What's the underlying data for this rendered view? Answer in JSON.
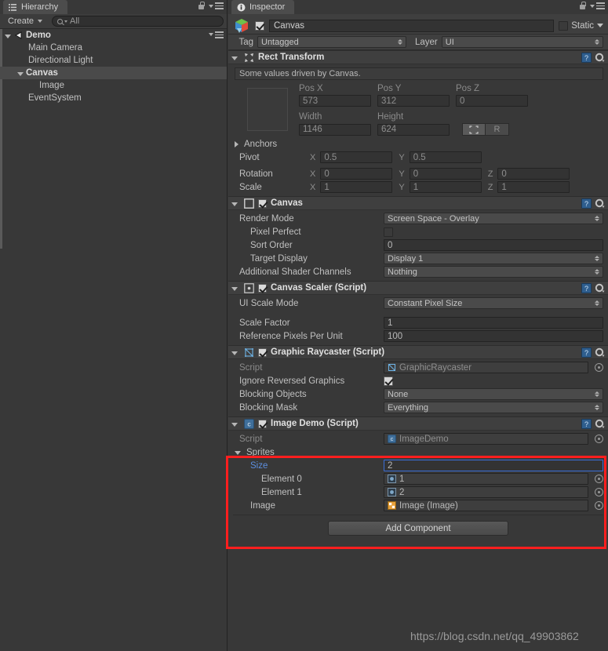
{
  "hierarchy": {
    "tab_label": "Hierarchy",
    "tab_icon": "hierarchy-list-icon",
    "create_label": "Create",
    "search_placeholder": "All",
    "tree": [
      {
        "label": "Demo",
        "depth": 0,
        "expanded": true,
        "icon": "unity-scene-icon",
        "selected": false,
        "bold": true
      },
      {
        "label": "Main Camera",
        "depth": 1,
        "expanded": null,
        "icon": "",
        "selected": false,
        "bold": false
      },
      {
        "label": "Directional Light",
        "depth": 1,
        "expanded": null,
        "icon": "",
        "selected": false,
        "bold": false
      },
      {
        "label": "Canvas",
        "depth": 1,
        "expanded": true,
        "icon": "",
        "selected": true,
        "bold": false
      },
      {
        "label": "Image",
        "depth": 2,
        "expanded": null,
        "icon": "",
        "selected": false,
        "bold": false
      },
      {
        "label": "EventSystem",
        "depth": 1,
        "expanded": null,
        "icon": "",
        "selected": false,
        "bold": false
      }
    ]
  },
  "inspector": {
    "tab_label": "Inspector",
    "tab_icon": "info-circle-icon",
    "object_name": "Canvas",
    "object_enabled": true,
    "static_label": "Static",
    "static_checked": false,
    "tag_label": "Tag",
    "tag_value": "Untagged",
    "layer_label": "Layer",
    "layer_value": "UI",
    "components": [
      {
        "title": "Rect Transform",
        "icon": "rect-transform-icon",
        "has_enable_checkbox": false,
        "helpbox": "Some values driven by Canvas.",
        "fields": {
          "pos_x_label": "Pos X",
          "pos_y_label": "Pos Y",
          "pos_z_label": "Pos Z",
          "pos_x": "573",
          "pos_y": "312",
          "pos_z": "0",
          "width_label": "Width",
          "height_label": "Height",
          "width": "1146",
          "height": "624",
          "blueprint_label": "R",
          "anchors_label": "Anchors",
          "pivot_label": "Pivot",
          "pivot_x": "0.5",
          "pivot_y": "0.5",
          "rotation_label": "Rotation",
          "rot_x": "0",
          "rot_y": "0",
          "rot_z": "0",
          "scale_label": "Scale",
          "scale_x": "1",
          "scale_y": "1",
          "scale_z": "1"
        }
      },
      {
        "title": "Canvas",
        "icon": "canvas-icon",
        "has_enable_checkbox": true,
        "enabled": true,
        "rows": [
          {
            "label": "Render Mode",
            "type": "popup",
            "value": "Screen Space - Overlay",
            "indent": 0
          },
          {
            "label": "Pixel Perfect",
            "type": "checkbox",
            "value": false,
            "indent": 1
          },
          {
            "label": "Sort Order",
            "type": "text",
            "value": "0",
            "indent": 1
          },
          {
            "label": "Target Display",
            "type": "popup",
            "value": "Display 1",
            "indent": 1
          },
          {
            "label": "Additional Shader Channels",
            "type": "popup",
            "value": "Nothing",
            "indent": 0
          }
        ]
      },
      {
        "title": "Canvas Scaler (Script)",
        "icon": "canvas-scaler-icon",
        "has_enable_checkbox": true,
        "enabled": true,
        "rows": [
          {
            "label": "UI Scale Mode",
            "type": "popup",
            "value": "Constant Pixel Size",
            "indent": 0
          },
          {
            "label": "Scale Factor",
            "type": "text",
            "value": "1",
            "indent": 0
          },
          {
            "label": "Reference Pixels Per Unit",
            "type": "text",
            "value": "100",
            "indent": 0
          }
        ]
      },
      {
        "title": "Graphic Raycaster (Script)",
        "icon": "graphic-raycaster-icon",
        "has_enable_checkbox": true,
        "enabled": true,
        "rows": [
          {
            "label": "Script",
            "type": "objref",
            "value": "GraphicRaycaster",
            "indent": 0,
            "dim": true,
            "ref_icon": "script-icon"
          },
          {
            "label": "Ignore Reversed Graphics",
            "type": "checkbox",
            "value": true,
            "indent": 0
          },
          {
            "label": "Blocking Objects",
            "type": "popup",
            "value": "None",
            "indent": 0
          },
          {
            "label": "Blocking Mask",
            "type": "popup",
            "value": "Everything",
            "indent": 0
          }
        ]
      },
      {
        "title": "Image Demo (Script)",
        "icon": "csharp-script-icon",
        "has_enable_checkbox": true,
        "enabled": true,
        "rows": [
          {
            "label": "Script",
            "type": "objref",
            "value": "ImageDemo",
            "indent": 0,
            "dim": true,
            "ref_icon": "csharp-script-icon"
          },
          {
            "label": "Sprites",
            "type": "foldout",
            "value": "",
            "indent": 0,
            "expanded": true
          },
          {
            "label": "Size",
            "type": "text-focused",
            "value": "2",
            "indent": 1,
            "highlight": true
          },
          {
            "label": "Element 0",
            "type": "objref",
            "value": "1",
            "indent": 2,
            "ref_icon": "sprite-icon"
          },
          {
            "label": "Element 1",
            "type": "objref",
            "value": "2",
            "indent": 2,
            "ref_icon": "sprite-icon"
          },
          {
            "label": "Image",
            "type": "objref",
            "value": "Image (Image)",
            "indent": 1,
            "ref_icon": "image-component-icon"
          }
        ]
      }
    ],
    "add_component_label": "Add Component"
  },
  "watermark": "https://blog.csdn.net/qq_49903862",
  "colors": {
    "panel_bg": "#383838",
    "header_bg": "#3f3f3f",
    "field_bg": "#333333",
    "selection": "#4a4a4a",
    "highlight_red": "#ff1e1e",
    "focus_blue": "#3a6fd8",
    "label_blue": "#5c8fe0"
  }
}
